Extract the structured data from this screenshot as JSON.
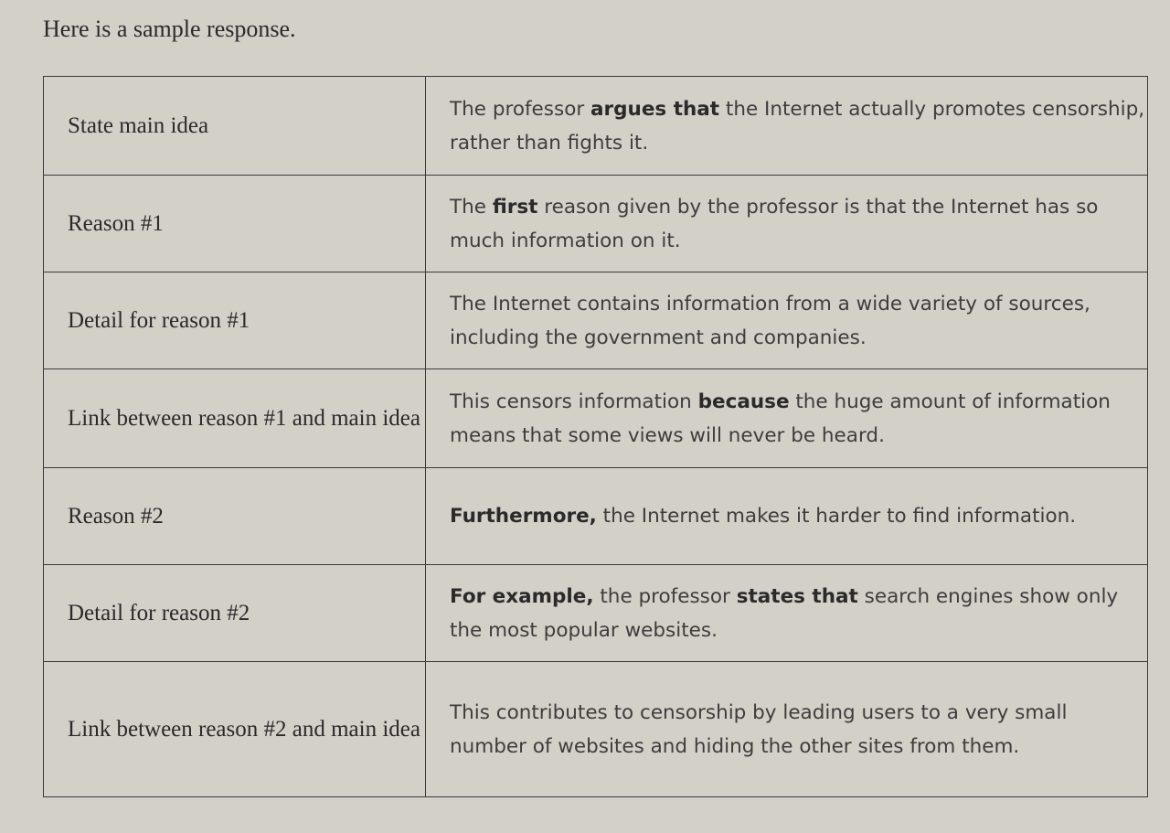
{
  "intro": "Here is a sample response.",
  "rows": [
    {
      "label": "State main idea",
      "text": [
        {
          "t": "The professor ",
          "b": false
        },
        {
          "t": "argues that",
          "b": true
        },
        {
          "t": " the Internet actually promotes censorship, rather than fights it.",
          "b": false
        }
      ]
    },
    {
      "label": "Reason #1",
      "text": [
        {
          "t": "The ",
          "b": false
        },
        {
          "t": "first",
          "b": true
        },
        {
          "t": " reason given by the professor is that the Internet has so much information on it.",
          "b": false
        }
      ]
    },
    {
      "label": "Detail for reason #1",
      "text": [
        {
          "t": "The Internet contains information from a wide variety of sources, including the government and companies.",
          "b": false
        }
      ]
    },
    {
      "label": "Link between reason #1 and main idea",
      "text": [
        {
          "t": "This censors information ",
          "b": false
        },
        {
          "t": "because",
          "b": true
        },
        {
          "t": " the huge amount of information means that some views will never be heard.",
          "b": false
        }
      ]
    },
    {
      "label": "Reason #2",
      "text": [
        {
          "t": "Furthermore,",
          "b": true
        },
        {
          "t": " the Internet makes it harder to find information.",
          "b": false
        }
      ]
    },
    {
      "label": "Detail for reason #2",
      "text": [
        {
          "t": "For example,",
          "b": true
        },
        {
          "t": " the professor ",
          "b": false
        },
        {
          "t": "states that",
          "b": true
        },
        {
          "t": " search engines show only the most popular websites.",
          "b": false
        }
      ]
    },
    {
      "label": "Link between reason #2 and main idea",
      "text": [
        {
          "t": "This contributes to censorship by leading users to a very small number of websites and hiding the other sites from them.",
          "b": false
        }
      ]
    }
  ]
}
